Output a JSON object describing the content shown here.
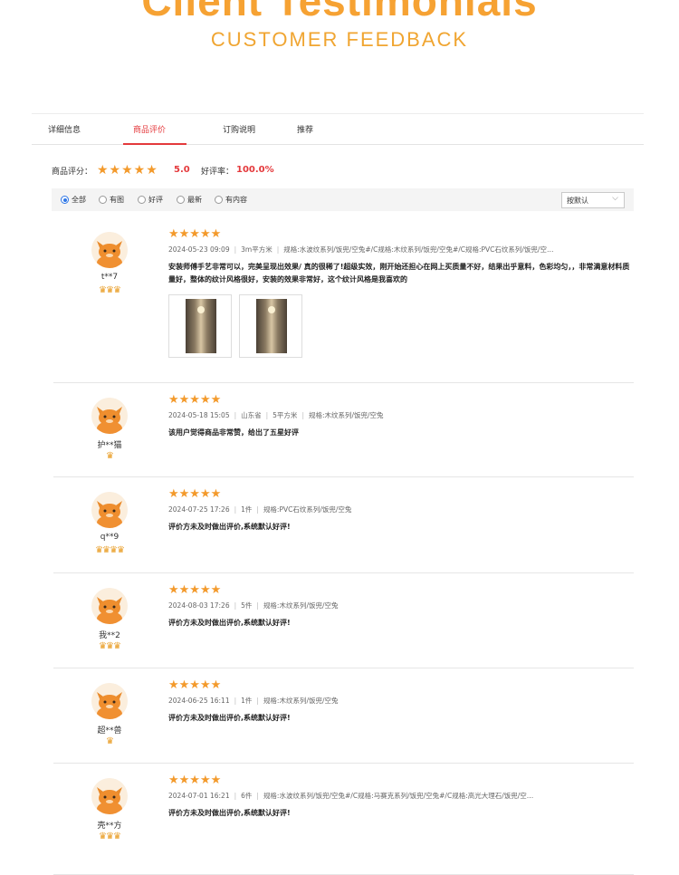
{
  "header": {
    "title": "Client Testimonials",
    "subtitle": "CUSTOMER FEEDBACK"
  },
  "tabs": [
    "详细信息",
    "商品评价",
    "订购说明",
    "推荐"
  ],
  "active_tab": "商品评价",
  "summary": {
    "label": "商品评分：",
    "stars": "★★★★★",
    "score": "5.0",
    "good_rate_label": "好评率：",
    "good_rate": "100.0%"
  },
  "filters": {
    "options": [
      "全部",
      "有图",
      "好评",
      "最新",
      "有内容"
    ],
    "selected": "全部",
    "sort_label": "按默认",
    "sort_icon": "chevron-down-icon"
  },
  "reviews": [
    {
      "user": "t**7",
      "medals": "♛♛♛",
      "stars": "★★★★★",
      "date": "2024-05-23 09:09",
      "qty": "3m平方米",
      "spec": "规格:水波纹系列/饭兜/空兔#/C规格:木纹系列/饭兜/空兔#/C规格:PVC石纹系列/饭兜/空…",
      "text": "安装师傅手艺非常可以，完美呈现出效果/ 真的很稀了!超级实效，刚开始还担心在网上买质量不好，结果出乎意料，色彩均匀，，非常满意材料质量好，整体的纹计风格很好，安装的效果非常好，这个纹计风格是我喜欢的",
      "images": [
        "photo-1",
        "photo-2"
      ]
    },
    {
      "user": "护**猫",
      "medals": "♛",
      "stars": "★★★★★",
      "date": "2024-05-18 15:05",
      "location": "山东省",
      "qty": "5平方米",
      "spec": "规格:木纹系列/饭兜/空兔",
      "text": "该用户觉得商品非常赞，给出了五星好评"
    },
    {
      "user": "q**9",
      "medals": "♛♛♛♛",
      "stars": "★★★★★",
      "date": "2024-07-25 17:26",
      "qty": "1件",
      "spec": "规格:PVC石纹系列/饭兜/空兔",
      "text": "评价方未及时做出评价,系统默认好评!"
    },
    {
      "user": "我**2",
      "medals": "♛♛♛",
      "stars": "★★★★★",
      "date": "2024-08-03 17:26",
      "qty": "5件",
      "spec": "规格:木纹系列/饭兜/空兔",
      "text": "评价方未及时做出评价,系统默认好评!"
    },
    {
      "user": "超**兽",
      "medals": "♛",
      "stars": "★★★★★",
      "date": "2024-06-25 16:11",
      "qty": "1件",
      "spec": "规格:木纹系列/饭兜/空兔",
      "text": "评价方未及时做出评价,系统默认好评!"
    },
    {
      "user": "壳**方",
      "medals": "♛♛♛",
      "stars": "★★★★★",
      "date": "2024-07-01 16:21",
      "qty": "6件",
      "spec": "规格:水波纹系列/饭兜/空兔#/C规格:马赛克系列/饭兜/空兔#/C规格:高光大理石/饭兜/空…",
      "text": "评价方未及时做出评价,系统默认好评!"
    }
  ],
  "colors": {
    "accent_orange": "#f6a233",
    "star": "#f39a2c",
    "red": "#e4393c",
    "radio_blue": "#2f77e6"
  }
}
